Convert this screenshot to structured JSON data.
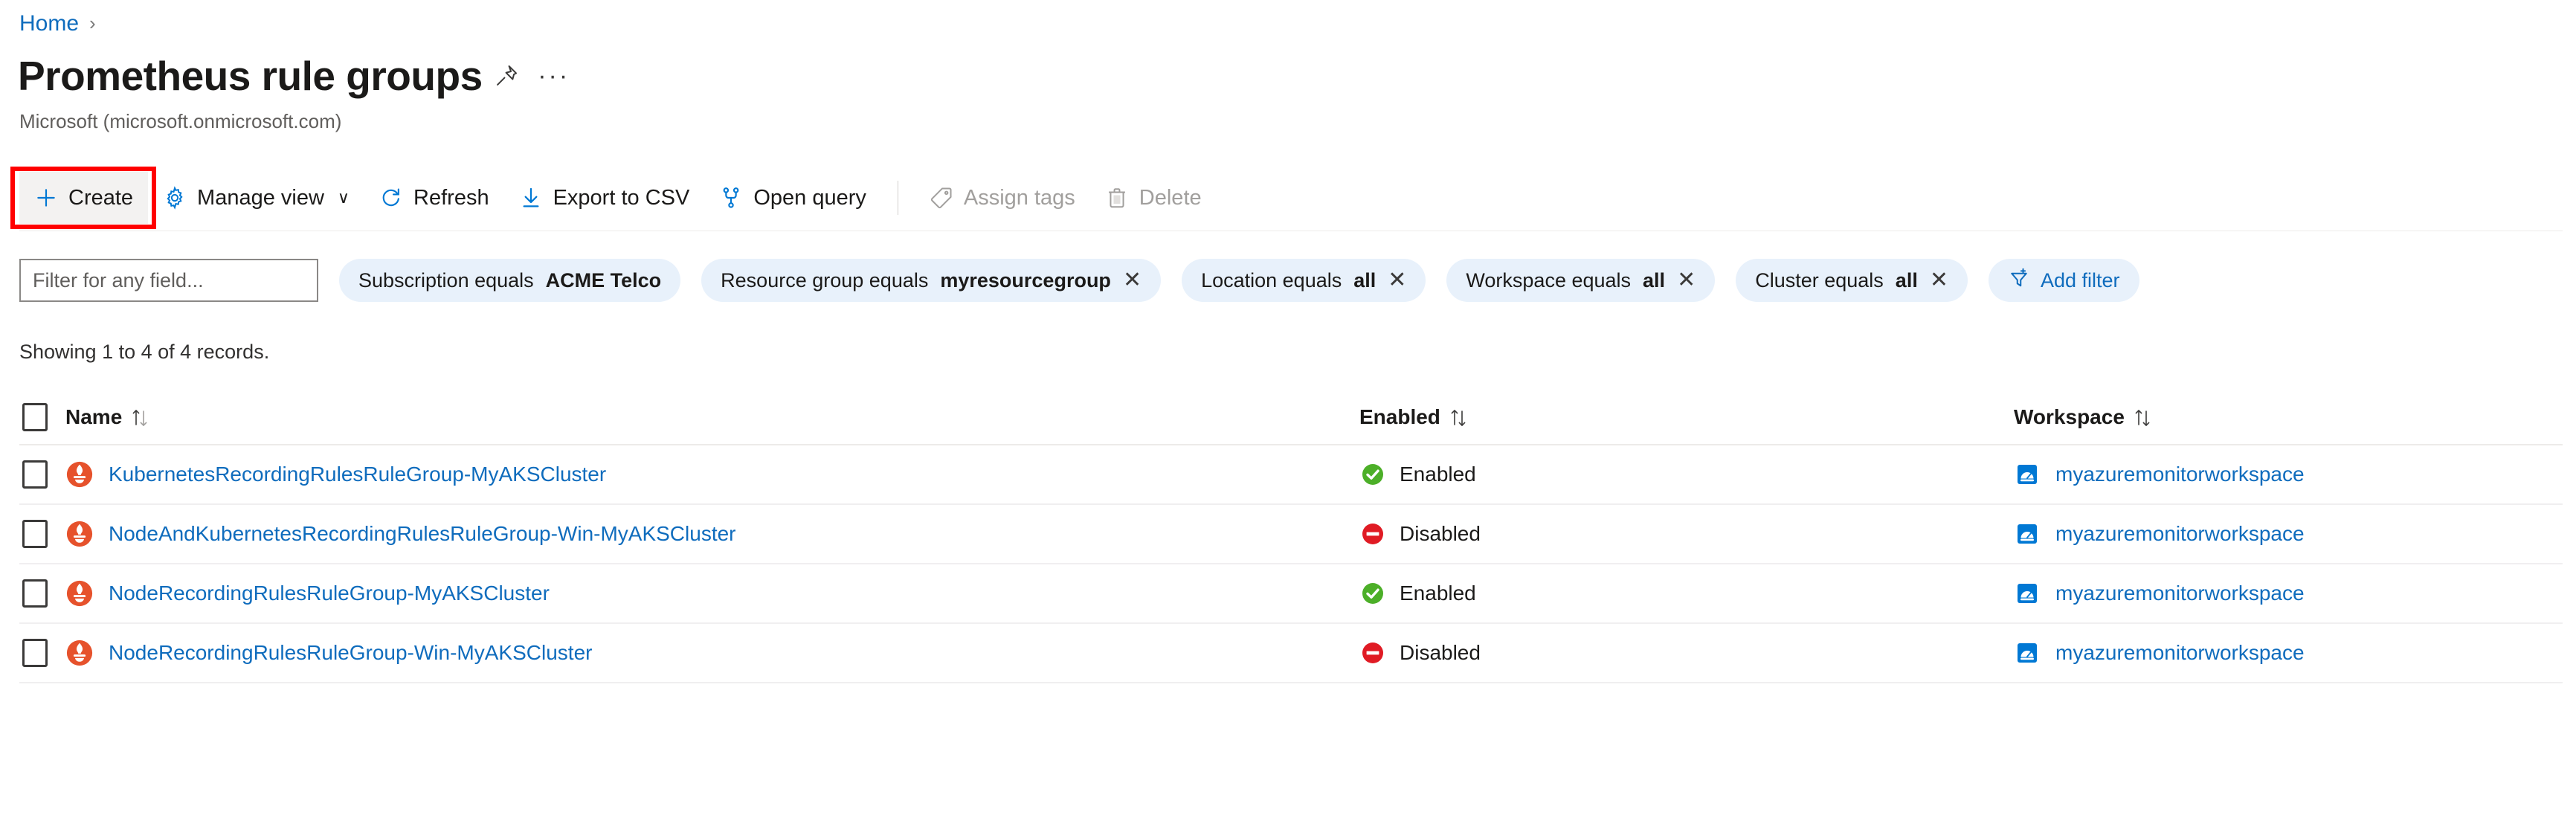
{
  "breadcrumb": {
    "items": [
      {
        "label": "Home"
      }
    ],
    "separator": "›"
  },
  "header": {
    "title": "Prometheus rule groups",
    "subtitle": "Microsoft (microsoft.onmicrosoft.com)",
    "pin_icon": "pin-icon",
    "more_label": "···",
    "more_icon": "ellipsis-icon"
  },
  "toolbar": {
    "items": [
      {
        "label": "Create",
        "icon": "plus-icon",
        "state": "active",
        "has_chevron": false
      },
      {
        "label": "Manage view",
        "icon": "gear-icon",
        "state": "normal",
        "has_chevron": true,
        "chevron": "∨"
      },
      {
        "label": "Refresh",
        "icon": "refresh-icon",
        "state": "normal",
        "has_chevron": false
      },
      {
        "label": "Export to CSV",
        "icon": "download-icon",
        "state": "normal",
        "has_chevron": false
      },
      {
        "label": "Open query",
        "icon": "query-icon",
        "state": "normal",
        "has_chevron": false
      },
      {
        "label": "Assign tags",
        "icon": "tag-icon",
        "state": "disabled",
        "has_chevron": false
      },
      {
        "label": "Delete",
        "icon": "trash-icon",
        "state": "disabled",
        "has_chevron": false
      }
    ]
  },
  "filters": {
    "search": {
      "placeholder": "Filter for any field...",
      "value": ""
    },
    "pills": [
      {
        "label": "Subscription equals",
        "value": "ACME Telco",
        "removable": false
      },
      {
        "label": "Resource group equals",
        "value": "myresourcegroup",
        "removable": true
      },
      {
        "label": "Location equals",
        "value": "all",
        "removable": true
      },
      {
        "label": "Workspace equals",
        "value": "all",
        "removable": true
      },
      {
        "label": "Cluster equals",
        "value": "all",
        "removable": true
      }
    ],
    "add_filter_label": "Add filter",
    "add_filter_icon": "add-filter-icon",
    "remove_glyph": "✕"
  },
  "summary": {
    "text": "Showing 1 to 4 of 4 records."
  },
  "table": {
    "columns": [
      {
        "label": "Name",
        "sortable": true
      },
      {
        "label": "Enabled",
        "sortable": true
      },
      {
        "label": "Workspace",
        "sortable": true
      }
    ],
    "sort_glyph": "↑↓",
    "rows": [
      {
        "name": "KubernetesRecordingRulesRuleGroup-MyAKSCluster",
        "name_icon": "prometheus-icon",
        "enabled_label": "Enabled",
        "enabled_state": "enabled",
        "enabled_icon": "check-circle-icon",
        "workspace": "myazuremonitorworkspace",
        "workspace_icon": "azure-monitor-workspace-icon"
      },
      {
        "name": "NodeAndKubernetesRecordingRulesRuleGroup-Win-MyAKSCluster",
        "name_icon": "prometheus-icon",
        "enabled_label": "Disabled",
        "enabled_state": "disabled",
        "enabled_icon": "block-circle-icon",
        "workspace": "myazuremonitorworkspace",
        "workspace_icon": "azure-monitor-workspace-icon"
      },
      {
        "name": "NodeRecordingRulesRuleGroup-MyAKSCluster",
        "name_icon": "prometheus-icon",
        "enabled_label": "Enabled",
        "enabled_state": "enabled",
        "enabled_icon": "check-circle-icon",
        "workspace": "myazuremonitorworkspace",
        "workspace_icon": "azure-monitor-workspace-icon"
      },
      {
        "name": "NodeRecordingRulesRuleGroup-Win-MyAKSCluster",
        "name_icon": "prometheus-icon",
        "enabled_label": "Disabled",
        "enabled_state": "disabled",
        "enabled_icon": "block-circle-icon",
        "workspace": "myazuremonitorworkspace",
        "workspace_icon": "azure-monitor-workspace-icon"
      }
    ]
  },
  "annotation": {
    "target": "create-button",
    "color": "#ff0000"
  },
  "colors": {
    "link": "#0f6cbd",
    "pill_bg": "#e8f1fb",
    "enabled_green": "#4caf28",
    "disabled_red": "#e01b24",
    "prometheus_orange": "#e6522c",
    "workspace_blue": "#0078d4",
    "accent": "#0078d4"
  }
}
